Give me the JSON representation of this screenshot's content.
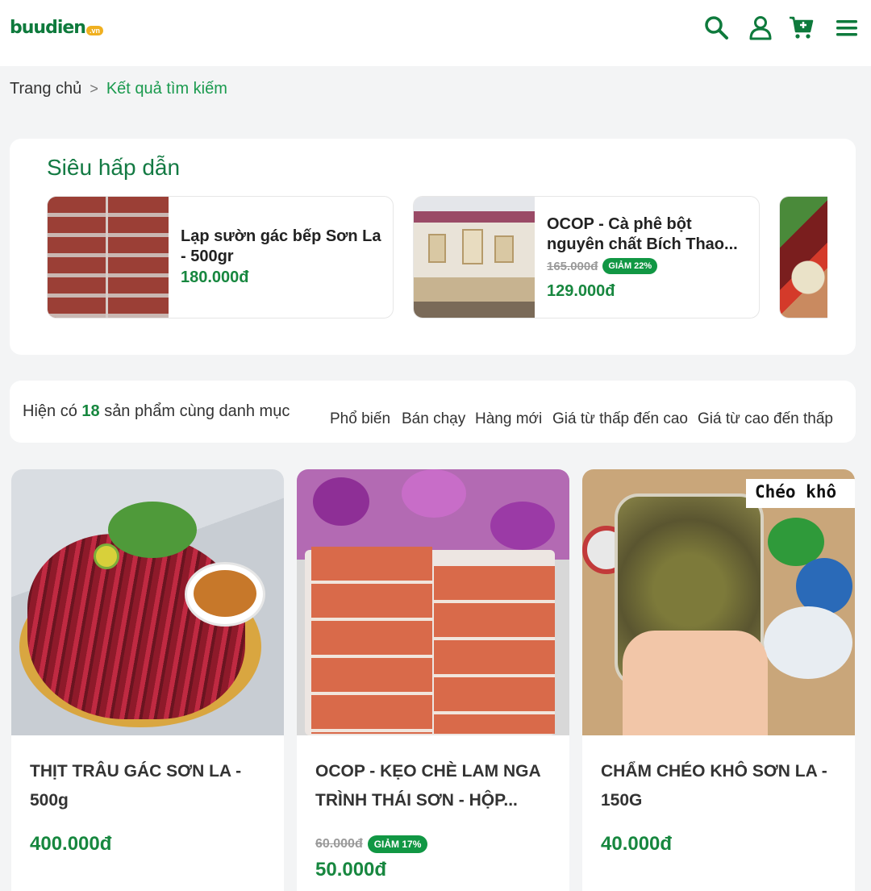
{
  "header": {
    "logo_text": "buudien",
    "logo_badge": ".vn",
    "icons": [
      "search-icon",
      "user-icon",
      "cart-icon",
      "menu-icon"
    ],
    "brand_color": "#0e7a3c"
  },
  "breadcrumb": {
    "home": "Trang chủ",
    "separator": ">",
    "current": "Kết quả tìm kiếm"
  },
  "featured": {
    "title": "Siêu hấp dẫn",
    "items": [
      {
        "name_line1": "Lạp sườn gác bếp Sơn La",
        "name_line2": "- 500gr",
        "price": "180.000đ"
      },
      {
        "name_line1": "OCOP - Cà phê bột",
        "name_line2": "nguyên chất Bích Thao...",
        "old_price": "165.000đ",
        "badge": "GIẢM 22%",
        "price": "129.000đ"
      }
    ]
  },
  "sortbar": {
    "count_prefix": "Hiện có",
    "count": "18",
    "count_suffix": "sản phẩm cùng danh mục",
    "options": [
      "Phổ biến",
      "Bán chạy",
      "Hàng mới",
      "Giá từ thấp đến cao",
      "Giá từ cao đến thấp"
    ]
  },
  "products": [
    {
      "name_line1": "THỊT TRÂU GÁC SƠN LA -",
      "name_line2": "500g",
      "price": "400.000đ"
    },
    {
      "name_line1": "OCOP - KẸO CHÈ LAM NGA",
      "name_line2": "TRÌNH THÁI SƠN - HỘP...",
      "old_price": "60.000đ",
      "badge": "GIẢM 17%",
      "price": "50.000đ"
    },
    {
      "name_line1": "CHẨM CHÉO KHÔ SƠN LA -",
      "name_line2": "150G",
      "price": "40.000đ",
      "image_caption": "Chéo khô"
    }
  ]
}
